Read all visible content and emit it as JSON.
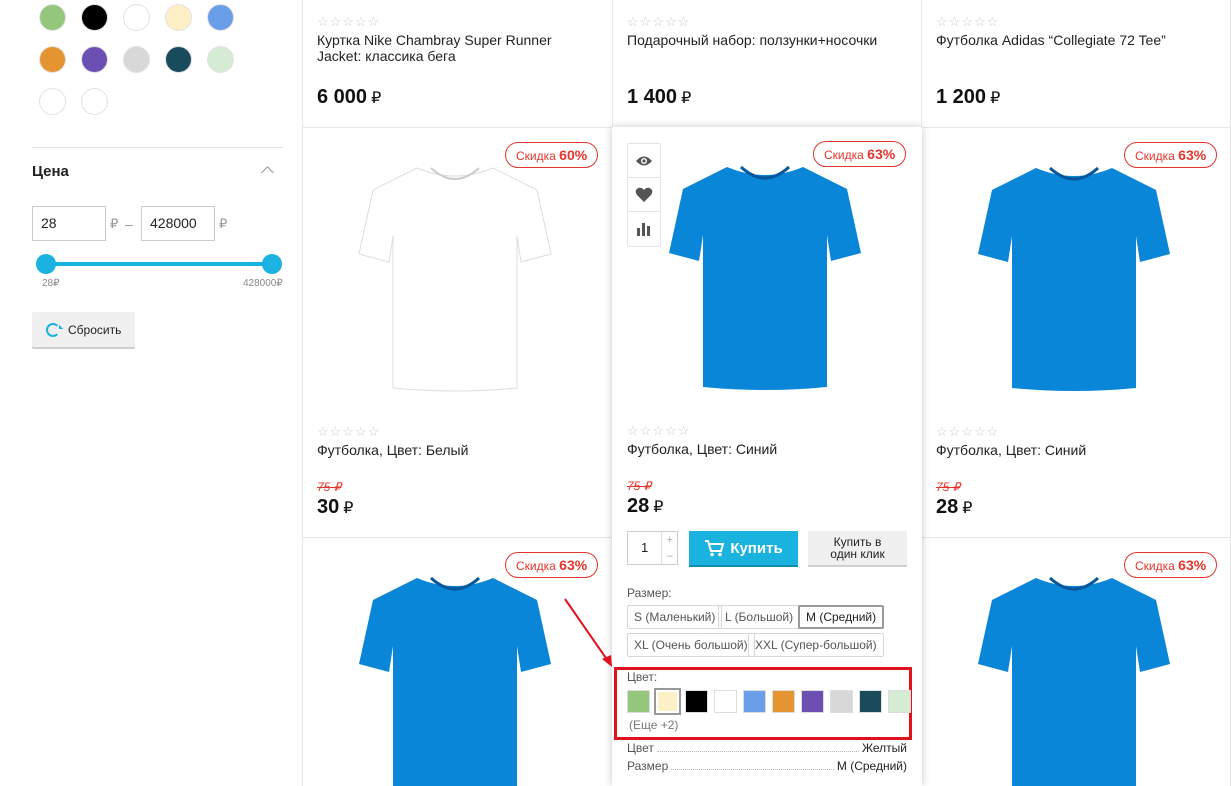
{
  "sidebar": {
    "color_swatches": [
      {
        "name": "green",
        "hex": "#94c67c"
      },
      {
        "name": "black",
        "hex": "#000000"
      },
      {
        "name": "white",
        "hex": "#ffffff"
      },
      {
        "name": "cream",
        "hex": "#fdefc6"
      },
      {
        "name": "blue",
        "hex": "#6a9ee9"
      },
      {
        "name": "orange",
        "hex": "#e59432"
      },
      {
        "name": "purple",
        "hex": "#6c4fb3"
      },
      {
        "name": "light-gray",
        "hex": "#d8d8d8"
      },
      {
        "name": "dark-teal",
        "hex": "#194b5d"
      },
      {
        "name": "pale-green",
        "hex": "#d6ebd4"
      },
      {
        "name": "white-2",
        "hex": "#ffffff"
      },
      {
        "name": "white-3",
        "hex": "#ffffff"
      }
    ],
    "price": {
      "title": "Цена",
      "min_value": "28",
      "max_value": "428000",
      "currency": "₽",
      "separator": "–",
      "min_label": "28₽",
      "max_label": "428000₽",
      "range_fraction": [
        0,
        1
      ]
    },
    "reset_label": "Сбросить"
  },
  "top_row": [
    {
      "name_line1": "Куртка Nike Chambray Super Runner",
      "name_line2": "Jacket: классика бега",
      "price": "6 000",
      "currency": "₽"
    },
    {
      "name_line1": "Подарочный набор: ползунки+носочки",
      "name_line2": "",
      "price": "1 400",
      "currency": "₽"
    },
    {
      "name_line1": "Футболка Adidas “Collegiate 72 Tee”",
      "name_line2": "",
      "price": "1 200",
      "currency": "₽"
    }
  ],
  "middle_row": [
    {
      "badge_text": "Скидка",
      "badge_pct": "60%",
      "name": "Футболка, Цвет: Белый",
      "old_price": "75 ₽",
      "price": "30",
      "currency": "₽",
      "shirt_color": "#ffffff"
    },
    {
      "badge_text": "Скидка",
      "badge_pct": "63%",
      "name": "Футболка, Цвет: Синий",
      "old_price": "75 ₽",
      "price": "28",
      "currency": "₽",
      "shirt_color": "#0a86d8"
    },
    {
      "badge_text": "Скидка",
      "badge_pct": "63%",
      "name": "Футболка, Цвет: Синий",
      "old_price": "75 ₽",
      "price": "28",
      "currency": "₽",
      "shirt_color": "#0a86d8"
    }
  ],
  "bottom_row": [
    {
      "badge_text": "Скидка",
      "badge_pct": "63%"
    },
    {
      "badge_text": "Скидка",
      "badge_pct": "63%"
    }
  ],
  "stars": "☆☆☆☆☆",
  "hover_card": {
    "quantity": "1",
    "buy_label": "Купить",
    "one_click_line1": "Купить в",
    "one_click_line2": "один клик",
    "size_label": "Размер:",
    "sizes": [
      "S (Маленький)",
      "L (Большой)",
      "M (Средний)",
      "XL (Очень большой)",
      "XXL (Супер-большой)"
    ],
    "selected_size": "M (Средний)",
    "color_label": "Цвет:",
    "colors": [
      {
        "name": "green",
        "hex": "#94c67c"
      },
      {
        "name": "cream",
        "hex": "#fdefc6"
      },
      {
        "name": "black",
        "hex": "#000000"
      },
      {
        "name": "white",
        "hex": "#ffffff"
      },
      {
        "name": "blue",
        "hex": "#6a9ee9"
      },
      {
        "name": "orange",
        "hex": "#e59432"
      },
      {
        "name": "purple",
        "hex": "#6c4fb3"
      },
      {
        "name": "light-gray",
        "hex": "#d8d8d8"
      },
      {
        "name": "dark-teal",
        "hex": "#194b5d"
      },
      {
        "name": "pale-green",
        "hex": "#d6ebd4"
      }
    ],
    "selected_color": "cream",
    "more_colors": "(Еще +2)",
    "prop_color_key": "Цвет",
    "prop_color_val": "Желтый",
    "prop_size_key": "Размер",
    "prop_size_val": "M (Средний)"
  },
  "accent_color": "#1ab3e0",
  "sale_color": "#e5342b",
  "highlight_color": "#e0101c"
}
